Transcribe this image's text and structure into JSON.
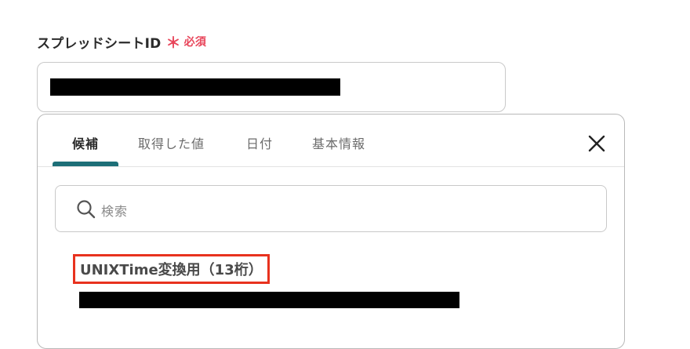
{
  "field": {
    "label": "スプレッドシートID",
    "required_mark": "＊",
    "required_text": "必須"
  },
  "tabs": [
    {
      "label": "候補",
      "active": true
    },
    {
      "label": "取得した値",
      "active": false
    },
    {
      "label": "日付",
      "active": false
    },
    {
      "label": "基本情報",
      "active": false
    }
  ],
  "search": {
    "placeholder": "検索"
  },
  "options": [
    {
      "title": "UNIXTime変換用（13桁）"
    }
  ],
  "colors": {
    "required": "#e8455a",
    "tab_underline": "#1d6f78",
    "highlight_border": "#e8321e"
  },
  "icons": {
    "close": "close-icon",
    "search": "search-icon"
  }
}
